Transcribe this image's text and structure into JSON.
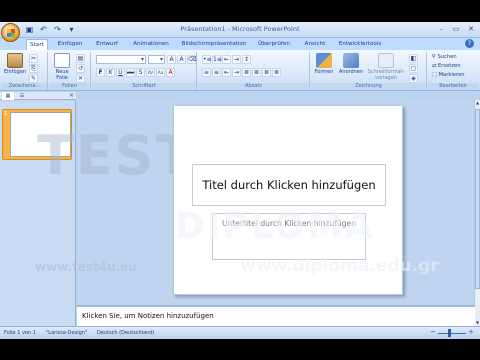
{
  "window": {
    "title": "Präsentation1 - Microsoft PowerPoint",
    "controls": [
      "–",
      "▭",
      "✕"
    ]
  },
  "quick_access": {
    "icons": [
      "save-icon",
      "undo-icon",
      "redo-icon",
      "dropdown-icon"
    ],
    "glyphs": [
      "▣",
      "↶",
      "↷",
      "▾"
    ]
  },
  "tabs": [
    {
      "label": "Start",
      "active": true
    },
    {
      "label": "Einfügen"
    },
    {
      "label": "Entwurf"
    },
    {
      "label": "Animationen"
    },
    {
      "label": "Bildschirmpräsentation"
    },
    {
      "label": "Überprüfen"
    },
    {
      "label": "Ansicht"
    },
    {
      "label": "Entwicklertools"
    }
  ],
  "help_glyph": "?",
  "ribbon": {
    "groups": {
      "clipboard": {
        "label": "Zwischena...",
        "paste": "Einfügen"
      },
      "slides": {
        "label": "Folien",
        "new_slide": "Neue Folie"
      },
      "font": {
        "label": "Schriftart"
      },
      "paragraph": {
        "label": "Absatz"
      },
      "drawing": {
        "label": "Zeichnung",
        "shapes": "Formen",
        "arrange": "Anordnen",
        "quick_styles": "Schnellformat-vorlagen"
      },
      "editing": {
        "label": "Bearbeiten",
        "find": "Suchen",
        "replace": "Ersetzen",
        "select": "Markieren"
      }
    },
    "font_buttons": [
      "F",
      "K",
      "U",
      "abc",
      "S",
      "AV",
      "Aa",
      "A"
    ],
    "size_buttons": [
      "A",
      "A",
      "⌫"
    ],
    "paragraph_buttons": [
      "≡",
      "≡",
      "⇤",
      "⇥",
      "≣",
      "≣",
      "≣",
      "≣"
    ],
    "paragraph_top": [
      "•≡",
      "1≡",
      "⇤",
      "⇥",
      "↕"
    ]
  },
  "panel": {
    "tabs": [
      "▦",
      "☰"
    ],
    "close": "×",
    "slide_number": "1"
  },
  "slide": {
    "title_placeholder": "Titel durch Klicken hinzufügen",
    "subtitle_placeholder": "Untertitel durch Klicken hinzufügen"
  },
  "notes": {
    "placeholder": "Klicken Sie, um Notizen hinzuzufügen"
  },
  "status": {
    "slide_of": "Folie 1 von 1",
    "theme": "\"Larissa-Design\"",
    "language": "Deutsch (Deutschland)"
  },
  "watermark": {
    "brand1": "TEST 4U",
    "brand2": "DIPLOMA",
    "url1": "www.test4u.eu",
    "url2": "www.diploma.edu.gr"
  }
}
